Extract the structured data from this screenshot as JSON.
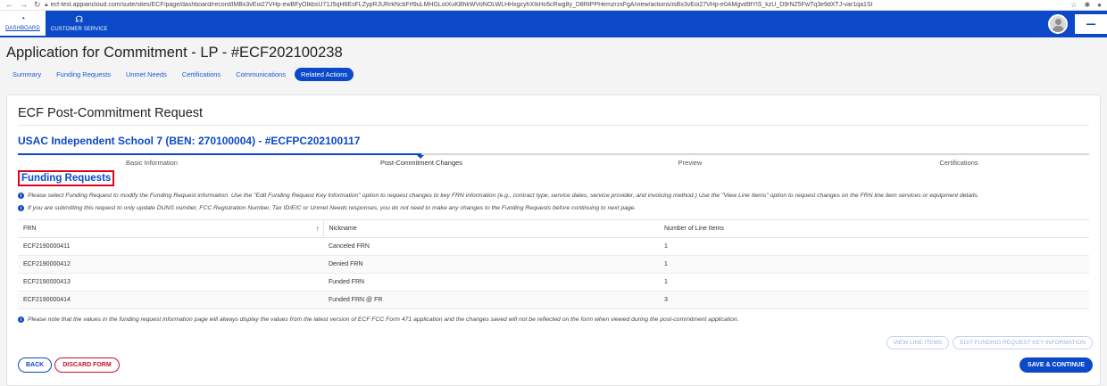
{
  "browser": {
    "url": "ecf-test.appiancloud.com/suite/sites/ECF/page/dashboard/record/lMBx3vEoi27VHp-ewBFyOIkbsU71J5qH6EsFLZypRJURrkNcbFrf9uLMHGLotXuKBhkWVoNOLWLHHxgcyhXIkHc6cRwg8y_D8RtPPHemzrzxFgA/view/actions/isBx3vEoi27VHp-e0AMgvd9fYlS_kzU_D9rNZ5FwTq3e9dXTJ-var1qa1SI"
  },
  "header": {
    "tabs": [
      {
        "label": "DASHBOARD",
        "icon": "dashboard-gauge-icon"
      },
      {
        "label": "CUSTOMER SERVICE",
        "icon": "headset-icon"
      }
    ]
  },
  "page": {
    "title": "Application for Commitment - LP - #ECF202100238",
    "tabs": [
      "Summary",
      "Funding Requests",
      "Unmet Needs",
      "Certifications",
      "Communications",
      "Related Actions"
    ],
    "active_tab": "Related Actions"
  },
  "form": {
    "title": "ECF Post-Commitment Request",
    "school": "USAC Independent School 7 (BEN: 270100004) - #ECFPC202100117",
    "steps": [
      "Basic Information",
      "Post-Commitment Changes",
      "Preview",
      "Certifications"
    ],
    "current_step": "Post-Commitment Changes",
    "section_title": "Funding Requests",
    "info1": "Please select Funding Request to modify the Funding Request information. Use the \"Edit Funding Request Key Information\" option to request changes to key FRN information (e.g., contract type, service dates, service provider, and invoicing method.) Use the \"View Line Items\" option to request changes on the FRN line item services or equipment details.",
    "info2": "If you are submitting this request to only update DUNS number, FCC Registration Number, Tax ID/EIC or Unmet Needs responses, you do not need to make any changes to the Funding Requests before continuing to next page.",
    "table": {
      "columns": [
        "FRN",
        "Nickname",
        "Number of Line Items"
      ],
      "rows": [
        [
          "ECF2190000411",
          "Canceled FRN",
          "1"
        ],
        [
          "ECF2190000412",
          "Denied FRN",
          "1"
        ],
        [
          "ECF2190000413",
          "Funded FRN",
          "1"
        ],
        [
          "ECF2190000414",
          "Funded FRN @ FR",
          "3"
        ]
      ]
    },
    "note": "Please note that the values in the funding request information page will always display the values from the latest version of ECF FCC Form 471 application and the changes saved will not be reflected on the form when viewed during the post-commitment application.",
    "buttons": {
      "view_line_items": "VIEW LINE ITEMS",
      "edit_key_info": "EDIT FUNDING REQUEST KEY INFORMATION",
      "back": "BACK",
      "discard": "DISCARD FORM",
      "save_continue": "SAVE & CONTINUE"
    }
  }
}
